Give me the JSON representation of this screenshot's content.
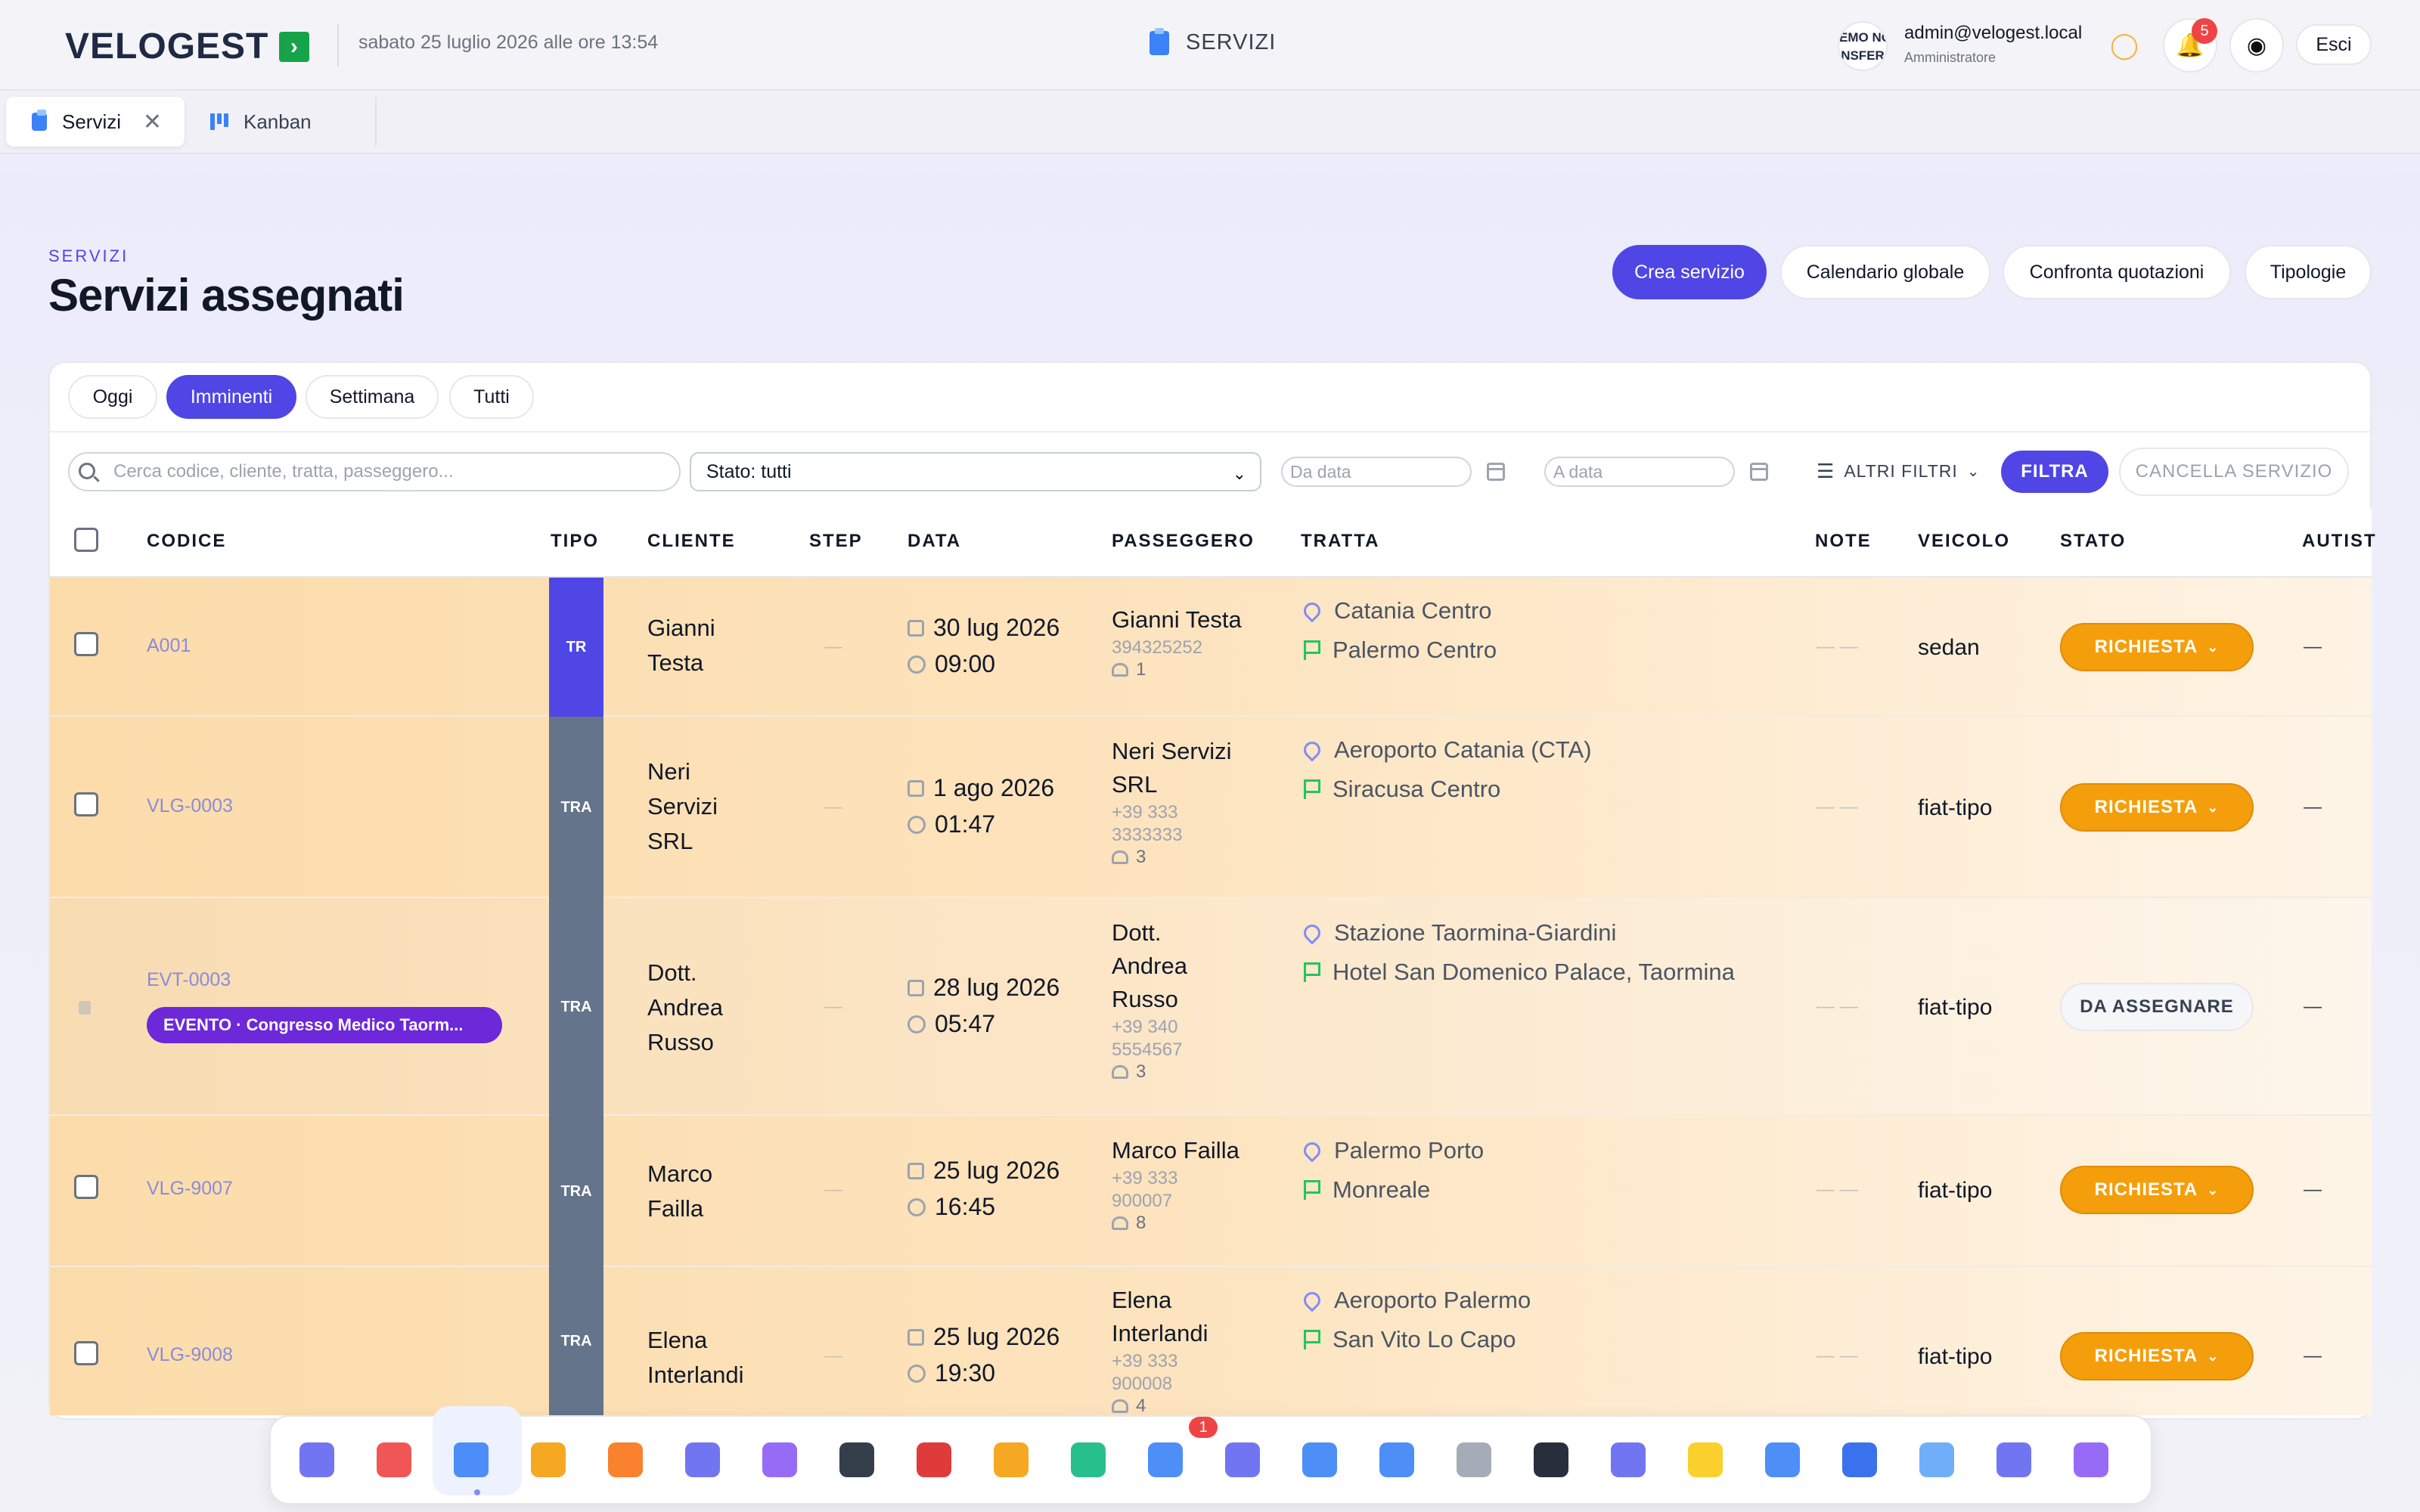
{
  "app": {
    "logo": "VELOGEST",
    "datetime": "sabato 25 luglio 2026 alle ore 13:54",
    "section_title": "SERVIZI",
    "avatar_text": "EMO NO\nNSFER",
    "user_email": "admin@velogest.local",
    "user_role": "Amministratore",
    "notifications": "5",
    "logout": "Esci"
  },
  "tabs": [
    {
      "label": "Servizi",
      "active": true
    },
    {
      "label": "Kanban",
      "active": false
    }
  ],
  "header": {
    "kicker": "SERVIZI",
    "title": "Servizi assegnati",
    "actions": [
      "Crea servizio",
      "Calendario globale",
      "Confronta quotazioni",
      "Tipologie"
    ]
  },
  "filters": {
    "chips": [
      "Oggi",
      "Imminenti",
      "Settimana",
      "Tutti"
    ],
    "active_chip": "Imminenti",
    "search_placeholder": "Cerca codice, cliente, tratta, passeggero...",
    "status_select": "Stato: tutti",
    "from_placeholder": "Da data",
    "to_placeholder": "A data",
    "more_filters": "ALTRI FILTRI",
    "filter_button": "FILTRA",
    "cancel_button": "CANCELLA SERVIZIO"
  },
  "table": {
    "columns": [
      "CODICE",
      "TIPO",
      "CLIENTE",
      "STEP",
      "DATA",
      "PASSEGGERO",
      "TRATTA",
      "NOTE",
      "VEICOLO",
      "STATO",
      "AUTIST"
    ],
    "rows": [
      {
        "code": "A001",
        "tipo": "TR",
        "cliente": "Gianni Testa",
        "step": "—",
        "date": "30 lug 2026",
        "time": "09:00",
        "passenger": "Gianni Testa",
        "phone": "394325252",
        "pax": "1",
        "from": "Catania Centro",
        "to": "Palermo Centro",
        "note": "— —",
        "vehicle": "sedan",
        "status": "RICHIESTA",
        "driver": "—"
      },
      {
        "code": "VLG-0003",
        "tipo": "TRA",
        "cliente": "Neri Servizi SRL",
        "step": "—",
        "date": "1 ago 2026",
        "time": "01:47",
        "passenger": "Neri Servizi SRL",
        "phone": "+39 333 3333333",
        "pax": "3",
        "from": "Aeroporto Catania (CTA)",
        "to": "Siracusa Centro",
        "note": "— —",
        "vehicle": "fiat-tipo",
        "status": "RICHIESTA",
        "driver": "—"
      },
      {
        "code": "EVT-0003",
        "event": "EVENTO · Congresso Medico Taorm...",
        "tipo": "TRA",
        "cliente": "Dott. Andrea Russo",
        "step": "—",
        "date": "28 lug 2026",
        "time": "05:47",
        "passenger": "Dott. Andrea Russo",
        "phone": "+39 340 5554567",
        "pax": "3",
        "from": "Stazione Taormina-Giardini",
        "to": "Hotel San Domenico Palace, Taormina",
        "note": "— —",
        "vehicle": "fiat-tipo",
        "status": "DA ASSEGNARE",
        "driver": "—"
      },
      {
        "code": "VLG-9007",
        "tipo": "TRA",
        "cliente": "Marco Failla",
        "step": "—",
        "date": "25 lug 2026",
        "time": "16:45",
        "passenger": "Marco Failla",
        "phone": "+39 333 900007",
        "pax": "8",
        "from": "Palermo Porto",
        "to": "Monreale",
        "note": "— —",
        "vehicle": "fiat-tipo",
        "status": "RICHIESTA",
        "driver": "—"
      },
      {
        "code": "VLG-9008",
        "tipo": "TRA",
        "cliente": "Elena Interlandi",
        "step": "—",
        "date": "25 lug 2026",
        "time": "19:30",
        "passenger": "Elena Interlandi",
        "phone": "+39 333 900008",
        "pax": "4",
        "from": "Aeroporto Palermo",
        "to": "San Vito Lo Capo",
        "note": "— —",
        "vehicle": "fiat-tipo",
        "status": "RICHIESTA",
        "driver": "—"
      }
    ]
  },
  "dock": {
    "badge": "1",
    "icons": [
      "apps-icon",
      "calendar-icon",
      "clipboard-icon",
      "flag-icon",
      "tag-icon",
      "users-icon",
      "network-icon",
      "driver-icon",
      "garage-icon",
      "package-icon",
      "route-icon",
      "presenter-icon",
      "calculator-icon",
      "kanban-icon",
      "headset-icon",
      "trash-icon",
      "terminal-icon",
      "add-user-icon",
      "star-icon",
      "building-icon",
      "globe-icon",
      "mail-icon",
      "user-key-icon",
      "briefcase-icon"
    ]
  },
  "colors": {
    "accent": "#4f46e5",
    "warning": "#f59e0b",
    "row_tint": "#fde9c9",
    "tipo_tr": "#4f46e5",
    "tipo_tra": "#64748b"
  }
}
